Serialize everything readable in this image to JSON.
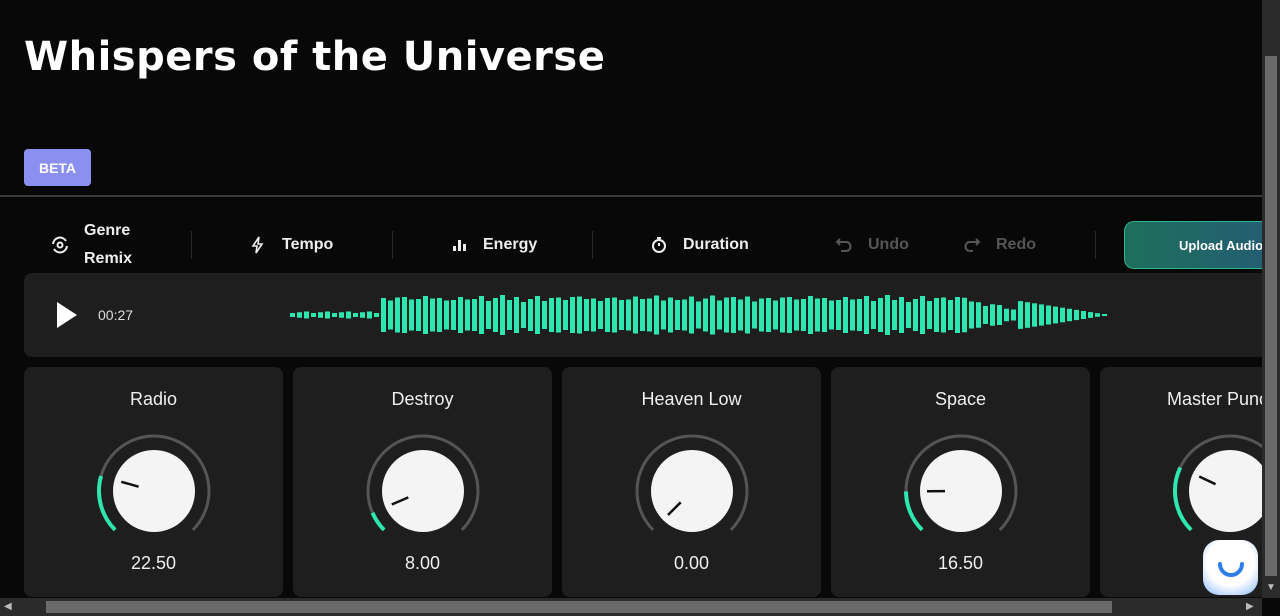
{
  "header": {
    "title": "Whispers of the Universe",
    "badge": "BETA"
  },
  "toolbar": {
    "genre_line1": "Genre",
    "genre_line2": "Remix",
    "tempo": "Tempo",
    "energy": "Energy",
    "duration": "Duration",
    "undo": "Undo",
    "redo": "Redo",
    "upload": "Upload Audio"
  },
  "player": {
    "time": "00:27",
    "accent": "#2ee6b0"
  },
  "knobs": [
    {
      "label": "Radio",
      "value": "22.50",
      "fraction": 0.225
    },
    {
      "label": "Destroy",
      "value": "8.00",
      "fraction": 0.08
    },
    {
      "label": "Heaven Low",
      "value": "0.00",
      "fraction": 0.0
    },
    {
      "label": "Space",
      "value": "16.50",
      "fraction": 0.165
    },
    {
      "label": "Master Punch",
      "value": "",
      "fraction": 0.26
    }
  ]
}
